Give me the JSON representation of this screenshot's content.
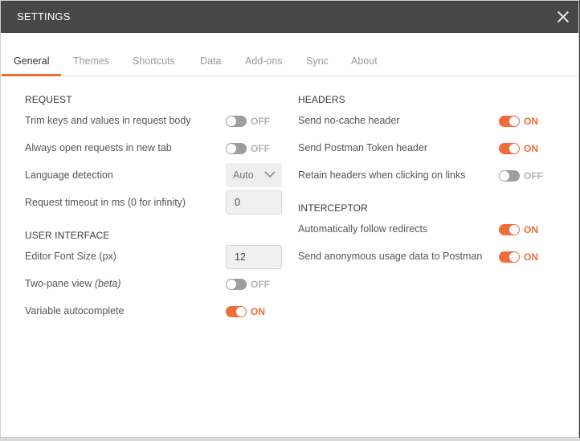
{
  "window": {
    "title": "SETTINGS"
  },
  "tabs": [
    {
      "label": "General",
      "active": true
    },
    {
      "label": "Themes"
    },
    {
      "label": "Shortcuts"
    },
    {
      "label": "Data"
    },
    {
      "label": "Add-ons"
    },
    {
      "label": "Sync"
    },
    {
      "label": "About"
    }
  ],
  "request": {
    "heading": "REQUEST",
    "trim_keys": {
      "label": "Trim keys and values in request body",
      "state": "OFF"
    },
    "always_open": {
      "label": "Always open requests in new tab",
      "state": "OFF"
    },
    "language_detection": {
      "label": "Language detection",
      "value": "Auto"
    },
    "timeout": {
      "label": "Request timeout in ms (0 for infinity)",
      "value": "0"
    }
  },
  "user_interface": {
    "heading": "USER INTERFACE",
    "font_size": {
      "label": "Editor Font Size (px)",
      "value": "12"
    },
    "two_pane": {
      "label": "Two-pane view ",
      "label_suffix": "(beta)",
      "state": "OFF"
    },
    "var_autocomplete": {
      "label": "Variable autocomplete",
      "state": "ON"
    }
  },
  "headers": {
    "heading": "HEADERS",
    "no_cache": {
      "label": "Send no-cache header",
      "state": "ON"
    },
    "postman_token": {
      "label": "Send Postman Token header",
      "state": "ON"
    },
    "retain_headers": {
      "label": "Retain headers when clicking on links",
      "state": "OFF"
    }
  },
  "interceptor": {
    "heading": "INTERCEPTOR",
    "follow_redirects": {
      "label": "Automatically follow redirects",
      "state": "ON"
    },
    "anon_usage": {
      "label": "Send anonymous usage data to Postman",
      "state": "ON"
    }
  },
  "colors": {
    "accent": "#f26b3a",
    "titlebar": "#474747",
    "toggle_off": "#9e9e9e"
  }
}
